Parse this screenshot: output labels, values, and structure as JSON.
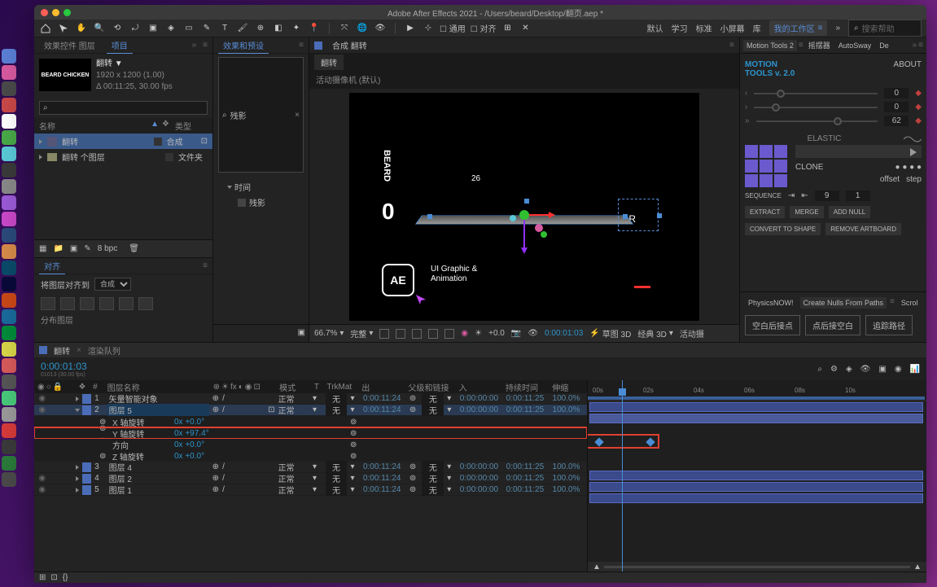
{
  "title": "Adobe After Effects 2021 - /Users/beard/Desktop/翻页.aep *",
  "menubar": {
    "workspaces": [
      "默认",
      "学习",
      "标准",
      "小屏幕",
      "库"
    ],
    "my_workspace": "我的工作区",
    "search_placeholder": "搜索帮助"
  },
  "project": {
    "tabs": {
      "controls": "效果控件 图层",
      "project": "项目"
    },
    "thumb_title": "BEARD CHICKEN",
    "thumb_name": "翻转 ▼",
    "thumb_info1": "1920 x 1200 (1.00)",
    "thumb_info2": "Δ 00:11:25, 30.00 fps",
    "cols": {
      "name": "名称",
      "type": "类型"
    },
    "items": [
      {
        "name": "翻转",
        "type": "合成"
      },
      {
        "name": "翻转 个图层",
        "type": "文件夹"
      }
    ],
    "footer_bpc": "8 bpc"
  },
  "align": {
    "title": "对齐",
    "label": "将图层对齐到",
    "target": "合成",
    "distribute": "分布图层"
  },
  "effects": {
    "tab": "效果和预设",
    "query": "残影",
    "node_parent": "时间",
    "node_child": "残影"
  },
  "viewer": {
    "header": "合成 翻转",
    "tab": "翻转",
    "active_cam": "活动摄像机 (默认)",
    "footer": {
      "zoom": "66.7%",
      "res": "完整",
      "exp": "+0.0",
      "time": "0:00:01:03",
      "mask3d": "草图 3D",
      "classic3d": "经典 3D",
      "cam_btn": "活动摄"
    },
    "canvas": {
      "beard": "BEARD",
      "zero": "0",
      "num": "26",
      "r": "R",
      "badge": "AE",
      "sub1": "UI Graphic &",
      "sub2": "Animation"
    }
  },
  "right": {
    "tabs": [
      "Motion Tools 2",
      "摇摆器",
      "AutoSway",
      "De"
    ],
    "mt_title1": "MOTION",
    "mt_title2": "TOOLS v. 2.0",
    "about": "ABOUT",
    "sliders": [
      {
        "val": "0",
        "pos": 18
      },
      {
        "val": "0",
        "pos": 14
      },
      {
        "val": "62",
        "pos": 64
      }
    ],
    "elastic": "ELASTIC",
    "clone": "CLONE",
    "offset": "offset",
    "step": "step",
    "sequence": "SEQUENCE",
    "seq_v1": "9",
    "seq_v2": "1",
    "btns": [
      "EXTRACT",
      "MERGE",
      "ADD NULL",
      "CONVERT TO SHAPE",
      "REMOVE ARTBOARD"
    ],
    "sub_tabs": [
      "PhysicsNOW!",
      "Create Nulls From Paths",
      "Scrol"
    ],
    "sub_btns": [
      "空白后接点",
      "点后接空白",
      "追踪路径"
    ]
  },
  "timeline": {
    "tabs": [
      "翻转",
      "渲染队列"
    ],
    "timecode": "0:00:01:03",
    "sub_tc": "01013 (30.00 fps)",
    "cols": {
      "layer_name": "图层名称",
      "mode": "模式",
      "trkmat": "TrkMat",
      "out": "出",
      "parent": "父级和链接",
      "in": "入",
      "duration": "持续时间",
      "stretch": "伸缩"
    },
    "layers": [
      {
        "idx": "1",
        "name": "矢量智能对象",
        "mode": "正常",
        "trk": "无",
        "out": "0:00:11:24",
        "in": "0:00:00:00",
        "dur": "0:00:11:25",
        "str": "100.0%"
      },
      {
        "idx": "2",
        "name": "图层 5",
        "mode": "正常",
        "trk": "无",
        "out": "0:00:11:24",
        "in": "0:00:00:00",
        "dur": "0:00:11:25",
        "str": "100.0%"
      },
      {
        "idx": "3",
        "name": "图层 4",
        "mode": "正常",
        "trk": "无",
        "out": "0:00:11:24",
        "in": "0:00:00:00",
        "dur": "0:00:11:25",
        "str": "100.0%"
      },
      {
        "idx": "4",
        "name": "图层 2",
        "mode": "正常",
        "trk": "无",
        "out": "0:00:11:24",
        "in": "0:00:00:00",
        "dur": "0:00:11:25",
        "str": "100.0%"
      },
      {
        "idx": "5",
        "name": "图层 1",
        "mode": "正常",
        "trk": "无",
        "out": "0:00:11:24",
        "in": "0:00:00:00",
        "dur": "0:00:11:25",
        "str": "100.0%"
      }
    ],
    "props": [
      {
        "name": "X 轴旋转",
        "val": "0x +0.0°"
      },
      {
        "name": "Y 轴旋转",
        "val": "0x +97.4°"
      },
      {
        "name": "方向",
        "val": "0x +0.0°"
      },
      {
        "name": "Z 轴旋转",
        "val": "0x +0.0°"
      }
    ],
    "ruler": [
      "00s",
      "02s",
      "04s",
      "06s",
      "08s",
      "10s"
    ]
  }
}
